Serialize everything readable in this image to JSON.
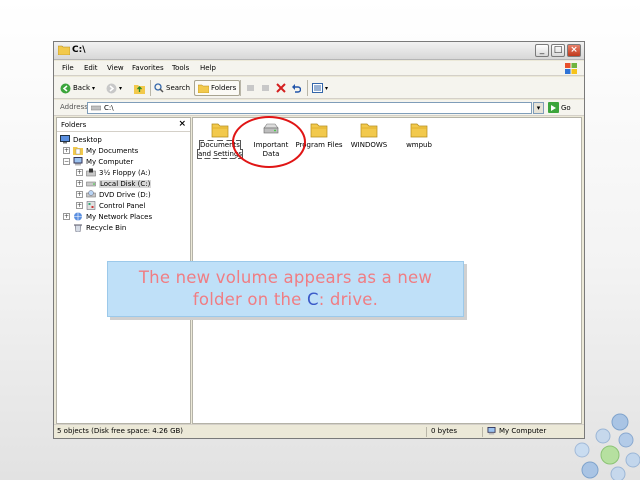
{
  "window": {
    "title": "C:\\"
  },
  "menu": [
    "File",
    "Edit",
    "View",
    "Favorites",
    "Tools",
    "Help"
  ],
  "toolbar": {
    "back_label": "Back",
    "search_label": "Search",
    "folders_label": "Folders"
  },
  "address": {
    "label": "Address",
    "value": "C:\\",
    "go_label": "Go"
  },
  "folders_pane": {
    "title": "Folders",
    "tree": [
      {
        "label": "Desktop",
        "expander": ""
      },
      {
        "label": "My Documents",
        "expander": "+"
      },
      {
        "label": "My Computer",
        "expander": "−"
      },
      {
        "label": "3½ Floppy (A:)",
        "expander": "+"
      },
      {
        "label": "Local Disk (C:)",
        "expander": "+"
      },
      {
        "label": "DVD Drive (D:)",
        "expander": "+"
      },
      {
        "label": "Control Panel",
        "expander": "+"
      },
      {
        "label": "My Network Places",
        "expander": "+"
      },
      {
        "label": "Recycle Bin",
        "expander": ""
      }
    ]
  },
  "files": [
    {
      "label_line1": "Documents",
      "label_line2": "and Settings",
      "icon": "folder-icon"
    },
    {
      "label_line1": "Important",
      "label_line2": "Data",
      "icon": "volume-drive-icon"
    },
    {
      "label_line1": "Program Files",
      "label_line2": "",
      "icon": "folder-icon"
    },
    {
      "label_line1": "WINDOWS",
      "label_line2": "",
      "icon": "folder-icon"
    },
    {
      "label_line1": "wmpub",
      "label_line2": "",
      "icon": "folder-icon"
    }
  ],
  "status": {
    "objects": "5 objects (Disk free space: 4.26 GB)",
    "size": "0 bytes",
    "zone": "My Computer"
  },
  "caption": {
    "line1": "The new volume appears as a new",
    "line2_before": "folder on the ",
    "line2_highlight": "C",
    "line2_after": ": drive."
  },
  "colors": {
    "caption_text": "#f07d83",
    "caption_highlight": "#3a5ac8",
    "caption_bg": "#bfe0f8",
    "callout_ring": "#e01515",
    "folder": "#f2c94c"
  }
}
